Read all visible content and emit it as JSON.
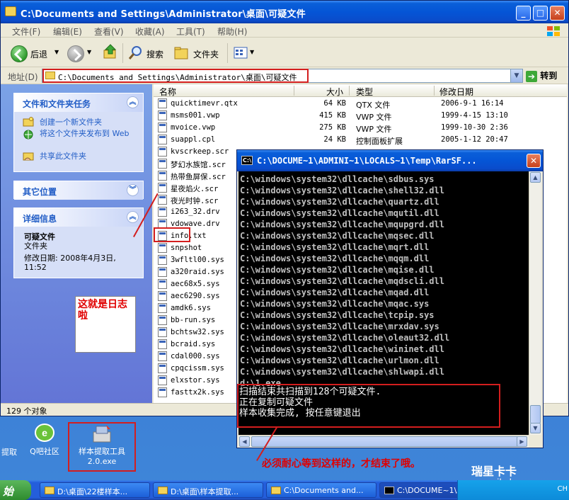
{
  "explorer": {
    "title": "C:\\Documents and Settings\\Administrator\\桌面\\可疑文件",
    "menu": [
      "文件(F)",
      "编辑(E)",
      "查看(V)",
      "收藏(A)",
      "工具(T)",
      "帮助(H)"
    ],
    "toolbar": {
      "back": "后退",
      "search": "搜索",
      "folders": "文件夹"
    },
    "address": {
      "label": "地址(D)",
      "value": "C:\\Documents and Settings\\Administrator\\桌面\\可疑文件",
      "go": "转到"
    },
    "tasks": {
      "file_folder_title": "文件和文件夹任务",
      "file_folder_items": [
        "创建一个新文件夹",
        "将这个文件夹发布到 Web",
        "共享此文件夹"
      ],
      "other_places_title": "其它位置",
      "details_title": "详细信息",
      "details_name": "可疑文件",
      "details_type": "文件夹",
      "details_modified": "修改日期: 2008年4月3日, 11:52"
    },
    "columns": {
      "name": "名称",
      "size": "大小",
      "type": "类型",
      "modified": "修改日期"
    },
    "files": [
      {
        "name": "quicktimevr.qtx",
        "size": "64 KB",
        "type": "QTX 文件",
        "modified": "2006-9-1 16:14"
      },
      {
        "name": "msms001.vwp",
        "size": "415 KB",
        "type": "VWP 文件",
        "modified": "1999-4-15 13:10"
      },
      {
        "name": "mvoice.vwp",
        "size": "275 KB",
        "type": "VWP 文件",
        "modified": "1999-10-30 2:36"
      },
      {
        "name": "suappl.cpl",
        "size": "24 KB",
        "type": "控制面板扩展",
        "modified": "2005-1-12 20:47"
      },
      {
        "name": "kvscrkeep.scr",
        "size": "",
        "type": "",
        "modified": ""
      },
      {
        "name": "梦幻水族馆.scr",
        "size": "",
        "type": "",
        "modified": ""
      },
      {
        "name": "热带鱼屏保.scr",
        "size": "",
        "type": "",
        "modified": ""
      },
      {
        "name": "星夜焰火.scr",
        "size": "",
        "type": "",
        "modified": ""
      },
      {
        "name": "夜光时钟.scr",
        "size": "",
        "type": "",
        "modified": ""
      },
      {
        "name": "i263_32.drv",
        "size": "",
        "type": "",
        "modified": ""
      },
      {
        "name": "vdowave.drv",
        "size": "",
        "type": "",
        "modified": ""
      },
      {
        "name": "info.txt",
        "size": "",
        "type": "",
        "modified": ""
      },
      {
        "name": "snpshot",
        "size": "",
        "type": "",
        "modified": ""
      },
      {
        "name": "3wfltl00.sys",
        "size": "",
        "type": "",
        "modified": ""
      },
      {
        "name": "a320raid.sys",
        "size": "",
        "type": "",
        "modified": ""
      },
      {
        "name": "aec68x5.sys",
        "size": "",
        "type": "",
        "modified": ""
      },
      {
        "name": "aec6290.sys",
        "size": "",
        "type": "",
        "modified": ""
      },
      {
        "name": "amdk6.sys",
        "size": "",
        "type": "",
        "modified": ""
      },
      {
        "name": "bb-run.sys",
        "size": "",
        "type": "",
        "modified": ""
      },
      {
        "name": "bchtsw32.sys",
        "size": "",
        "type": "",
        "modified": ""
      },
      {
        "name": "bcraid.sys",
        "size": "",
        "type": "",
        "modified": ""
      },
      {
        "name": "cdal000.sys",
        "size": "",
        "type": "",
        "modified": ""
      },
      {
        "name": "cpqcissm.sys",
        "size": "",
        "type": "",
        "modified": ""
      },
      {
        "name": "elxstor.sys",
        "size": "",
        "type": "",
        "modified": ""
      },
      {
        "name": "fasttx2k.sys",
        "size": "",
        "type": "",
        "modified": ""
      }
    ],
    "status": "129 个对象"
  },
  "annotations": {
    "log_note": "这就是日志啦",
    "wait_note": "必须耐心等到这样的，才结束了哦。"
  },
  "cmd": {
    "title": "C:\\DOCUME~1\\ADMINI~1\\LOCALS~1\\Temp\\RarSF...",
    "lines": [
      "C:\\windows\\system32\\dllcache\\sdbus.sys",
      "C:\\windows\\system32\\dllcache\\shell32.dll",
      "C:\\windows\\system32\\dllcache\\quartz.dll",
      "C:\\windows\\system32\\dllcache\\mqutil.dll",
      "C:\\windows\\system32\\dllcache\\mqupgrd.dll",
      "C:\\windows\\system32\\dllcache\\mqsec.dll",
      "C:\\windows\\system32\\dllcache\\mqrt.dll",
      "C:\\windows\\system32\\dllcache\\mqqm.dll",
      "C:\\windows\\system32\\dllcache\\mqise.dll",
      "C:\\windows\\system32\\dllcache\\mqdscli.dll",
      "C:\\windows\\system32\\dllcache\\mqad.dll",
      "C:\\windows\\system32\\dllcache\\mqac.sys",
      "C:\\windows\\system32\\dllcache\\tcpip.sys",
      "C:\\windows\\system32\\dllcache\\mrxdav.sys",
      "C:\\windows\\system32\\dllcache\\oleaut32.dll",
      "C:\\windows\\system32\\dllcache\\wininet.dll",
      "C:\\windows\\system32\\dllcache\\urlmon.dll",
      "C:\\windows\\system32\\dllcache\\shlwapi.dll",
      "d:\\1.exe"
    ],
    "result_lines": [
      "扫描结束共扫描到128个可疑文件.",
      "正在复制可疑文件",
      "样本收集完成, 按任意键退出"
    ]
  },
  "desktop": {
    "icons": [
      {
        "label": "提取"
      },
      {
        "label": "Q吧社区"
      },
      {
        "label": "样本提取工具 2.0.exe"
      }
    ],
    "tool_name": "样本提取工具",
    "tool_version": "2.0.exe"
  },
  "taskbar": {
    "start": "始",
    "tasks": [
      "D:\\桌面\\22楼样本...",
      "D:\\桌面\\样本提取...",
      "C:\\Documents and...",
      "C:\\DOCUME~1\\ADMI..."
    ],
    "tray_text": "CH"
  },
  "watermark": {
    "line1": "瑞星卡卡",
    "line2": "www.ikaka.com"
  }
}
